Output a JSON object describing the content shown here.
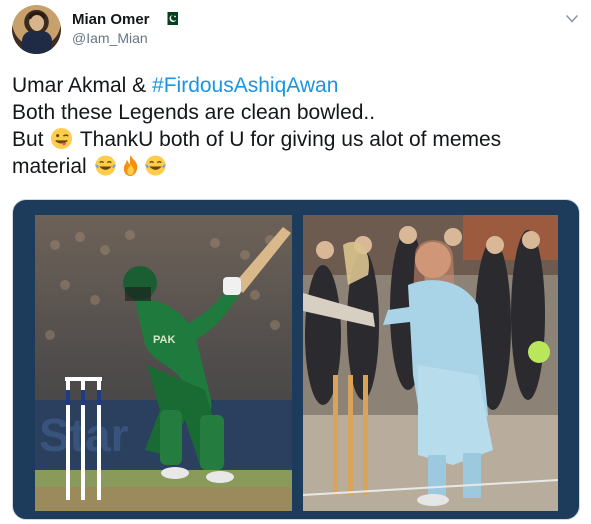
{
  "tweet": {
    "author": {
      "display_name": "Mian Omer",
      "handle": "@Iam_Mian",
      "avatar_icon": "user-avatar",
      "flag_icon": "pakistan-flag-icon"
    },
    "menu_icon": "chevron-down-icon",
    "text": {
      "line1_prefix": "Umar Akmal & ",
      "line1_hashtag": "#FirdousAshiqAwan",
      "line2": "Both these Legends are clean bowled..",
      "line3_prefix": "But ",
      "line3_text": " ThankU both of U  for giving us alot of  memes",
      "line4_prefix": "material "
    },
    "emojis": {
      "line3": [
        "winking-face-tongue-emoji"
      ],
      "line4": [
        "tears-of-joy-emoji",
        "fire-emoji",
        "tears-of-joy-emoji"
      ]
    },
    "media": {
      "left_photo": "cricketer-batting-photo",
      "right_photo": "woman-batting-photo"
    },
    "colors": {
      "hashtag": "#1b95e0",
      "name": "#14171a",
      "handle": "#657786",
      "media_frame": "#1d3c5c",
      "flag_green": "#01411c"
    }
  }
}
